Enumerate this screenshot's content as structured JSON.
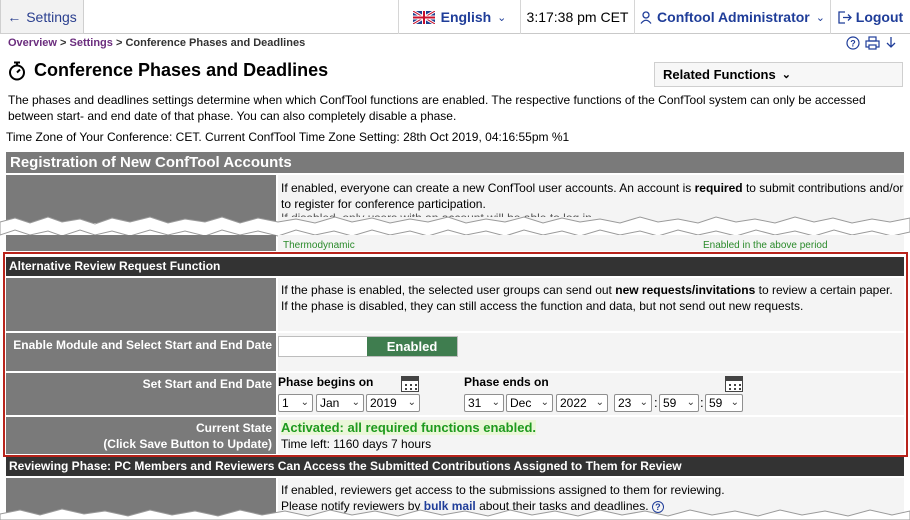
{
  "topbar": {
    "back_label": "Settings",
    "language": "English",
    "time": "3:17:38 pm CET",
    "user": "Conftool Administrator",
    "logout": "Logout"
  },
  "breadcrumb": {
    "overview": "Overview",
    "settings": "Settings",
    "current": "Conference Phases and Deadlines",
    "sep": ">"
  },
  "page": {
    "title": "Conference Phases and Deadlines",
    "related": "Related Functions",
    "intro": "The phases and deadlines settings determine when which ConfTool functions are enabled. The respective functions of the ConfTool system can only be accessed between start- and end date of that phase. You can also completely disable a phase.",
    "timezone": "Time Zone of Your Conference: CET. Current ConfTool Time Zone Setting: 28th Oct 2019, 04:16:55pm %1"
  },
  "registration": {
    "header": "Registration of New ConfTool Accounts",
    "desc_a": "If enabled, everyone can create a new ConfTool user accounts. An account is ",
    "desc_b": "required",
    "desc_c": " to submit contributions and/or to register for conference participation.",
    "cut_text": "If disabled, only users with an account will be able to log in.",
    "thermo": "Thermodynamic",
    "enabled_period": "Enabled in the above period"
  },
  "alt_review": {
    "header": "Alternative Review Request Function",
    "desc_a": "If the phase is enabled, the selected user groups can send out ",
    "desc_b": "new requests/invitations",
    "desc_c": " to review a certain paper.",
    "desc_d": "If the phase is disabled, they can still access the function and data, but not send out new requests.",
    "enable_label": "Enable Module and Select Start and End Date",
    "toggle_state": "Enabled",
    "dates_label": "Set Start and End Date",
    "phase_begins": "Phase begins on",
    "phase_ends": "Phase ends on",
    "begin_day": "1",
    "begin_month": "Jan",
    "begin_year": "2019",
    "end_day": "31",
    "end_month": "Dec",
    "end_year": "2022",
    "end_hour": "23",
    "end_min": "59",
    "end_sec": "59",
    "colon": ":",
    "state_label_1": "Current State",
    "state_label_2": "(Click Save Button to Update)",
    "state_active": "Activated: all required functions enabled.",
    "time_left": "Time left: 1160 days 7 hours"
  },
  "reviewing": {
    "header": "Reviewing Phase: PC Members and Reviewers Can Access the Submitted Contributions Assigned to Them for Review",
    "desc_a": "If enabled, reviewers get access to the submissions assigned to them for reviewing.",
    "desc_b": "Please notify reviewers by ",
    "bulk_mail": "bulk mail",
    "desc_c": " about their tasks and deadlines."
  },
  "icons": {
    "back": "arrow-left-icon",
    "flag": "uk-flag-icon",
    "user": "user-icon",
    "logout": "logout-icon",
    "help": "help-icon",
    "print": "print-icon",
    "download": "download-icon",
    "stopwatch": "stopwatch-icon",
    "calendar": "calendar-icon"
  }
}
